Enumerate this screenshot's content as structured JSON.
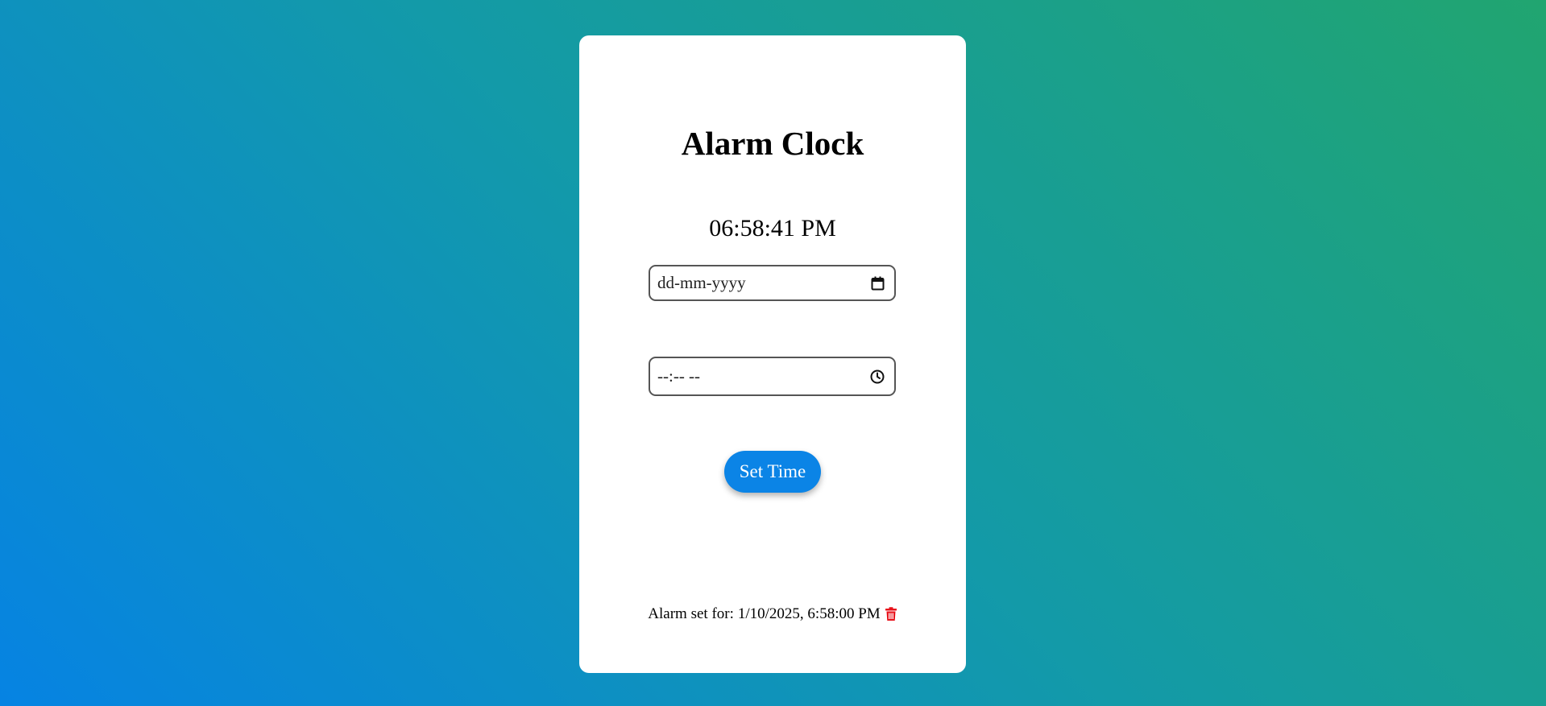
{
  "app": {
    "title": "Alarm Clock",
    "current_time": "06:58:41 PM"
  },
  "form": {
    "date_placeholder": "dd-mm-yyyy",
    "date_icon": "calendar-icon",
    "time_placeholder": "--:-- --",
    "time_icon": "clock-icon",
    "set_button_label": "Set Time"
  },
  "alarm": {
    "label": "Alarm set for:",
    "value": "1/10/2025, 6:58:00 PM",
    "delete_icon": "trash-icon"
  },
  "colors": {
    "background_start": "#0683e3",
    "background_end": "#21a570",
    "button": "#0b84e6",
    "delete_icon": "#e8121b"
  }
}
